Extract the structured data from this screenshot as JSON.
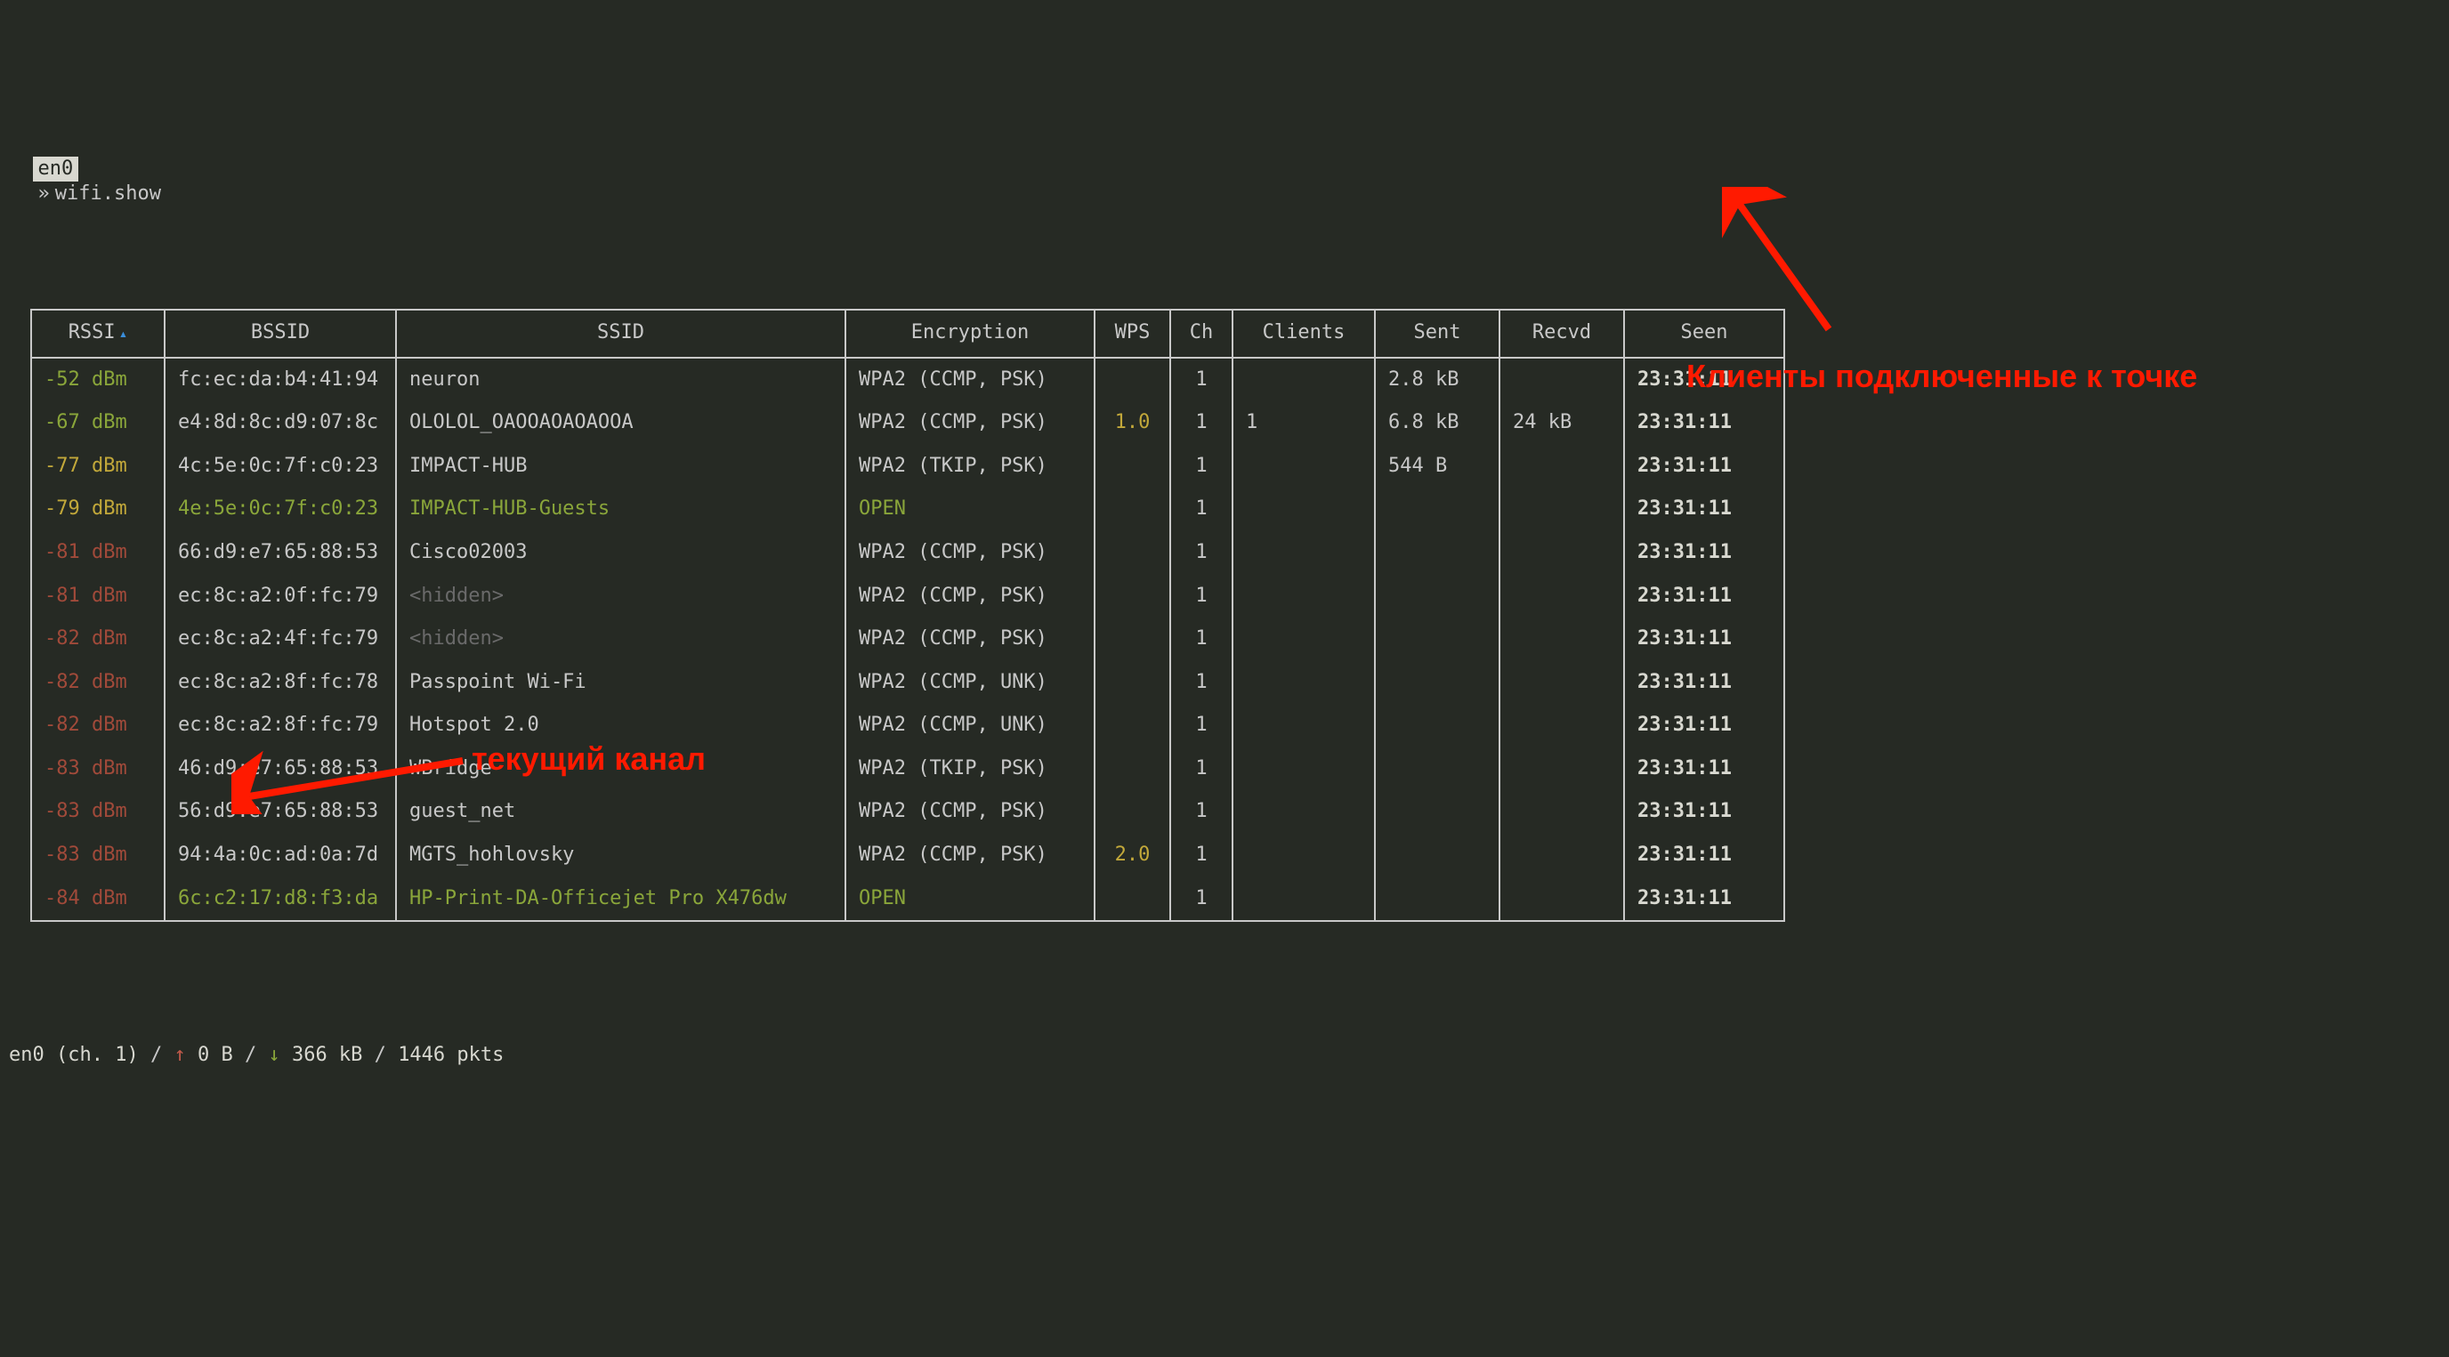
{
  "prompt": {
    "interface": "en0",
    "arrow": "»",
    "command": "wifi.show"
  },
  "columns": [
    "RSSI",
    "BSSID",
    "SSID",
    "Encryption",
    "WPS",
    "Ch",
    "Clients",
    "Sent",
    "Recvd",
    "Seen"
  ],
  "sort": {
    "column": "RSSI",
    "direction_glyph": "▴"
  },
  "rows": [
    {
      "rssi": "-52 dBm",
      "rssi_class": "c-green",
      "bssid": "fc:ec:da:b4:41:94",
      "bssid_class": "",
      "ssid": "neuron",
      "ssid_class": "",
      "enc": "WPA2 (CCMP, PSK)",
      "enc_class": "",
      "wps": "",
      "wps_class": "",
      "ch": "1",
      "clients": "",
      "sent": "2.8 kB",
      "recvd": "",
      "seen": "23:31:11"
    },
    {
      "rssi": "-67 dBm",
      "rssi_class": "c-green",
      "bssid": "e4:8d:8c:d9:07:8c",
      "bssid_class": "",
      "ssid": "OLOLOL_OAOOAOAOAOOA",
      "ssid_class": "",
      "enc": "WPA2 (CCMP, PSK)",
      "enc_class": "",
      "wps": "1.0",
      "wps_class": "c-yellow",
      "ch": "1",
      "clients": "1",
      "sent": "6.8 kB",
      "recvd": "24 kB",
      "seen": "23:31:11"
    },
    {
      "rssi": "-77 dBm",
      "rssi_class": "c-yellow",
      "bssid": "4c:5e:0c:7f:c0:23",
      "bssid_class": "",
      "ssid": "IMPACT-HUB",
      "ssid_class": "",
      "enc": "WPA2 (TKIP, PSK)",
      "enc_class": "",
      "wps": "",
      "wps_class": "",
      "ch": "1",
      "clients": "",
      "sent": "544 B",
      "recvd": "",
      "seen": "23:31:11"
    },
    {
      "rssi": "-79 dBm",
      "rssi_class": "c-yellow",
      "bssid": "4e:5e:0c:7f:c0:23",
      "bssid_class": "c-green",
      "ssid": "IMPACT-HUB-Guests",
      "ssid_class": "c-green",
      "enc": "OPEN",
      "enc_class": "c-green",
      "wps": "",
      "wps_class": "",
      "ch": "1",
      "clients": "",
      "sent": "",
      "recvd": "",
      "seen": "23:31:11"
    },
    {
      "rssi": "-81 dBm",
      "rssi_class": "c-red",
      "bssid": "66:d9:e7:65:88:53",
      "bssid_class": "",
      "ssid": "Cisco02003",
      "ssid_class": "",
      "enc": "WPA2 (CCMP, PSK)",
      "enc_class": "",
      "wps": "",
      "wps_class": "",
      "ch": "1",
      "clients": "",
      "sent": "",
      "recvd": "",
      "seen": "23:31:11"
    },
    {
      "rssi": "-81 dBm",
      "rssi_class": "c-red",
      "bssid": "ec:8c:a2:0f:fc:79",
      "bssid_class": "",
      "ssid": "<hidden>",
      "ssid_class": "c-dim",
      "enc": "WPA2 (CCMP, PSK)",
      "enc_class": "",
      "wps": "",
      "wps_class": "",
      "ch": "1",
      "clients": "",
      "sent": "",
      "recvd": "",
      "seen": "23:31:11"
    },
    {
      "rssi": "-82 dBm",
      "rssi_class": "c-red",
      "bssid": "ec:8c:a2:4f:fc:79",
      "bssid_class": "",
      "ssid": "<hidden>",
      "ssid_class": "c-dim",
      "enc": "WPA2 (CCMP, PSK)",
      "enc_class": "",
      "wps": "",
      "wps_class": "",
      "ch": "1",
      "clients": "",
      "sent": "",
      "recvd": "",
      "seen": "23:31:11"
    },
    {
      "rssi": "-82 dBm",
      "rssi_class": "c-red",
      "bssid": "ec:8c:a2:8f:fc:78",
      "bssid_class": "",
      "ssid": "Passpoint Wi-Fi",
      "ssid_class": "",
      "enc": "WPA2 (CCMP, UNK)",
      "enc_class": "",
      "wps": "",
      "wps_class": "",
      "ch": "1",
      "clients": "",
      "sent": "",
      "recvd": "",
      "seen": "23:31:11"
    },
    {
      "rssi": "-82 dBm",
      "rssi_class": "c-red",
      "bssid": "ec:8c:a2:8f:fc:79",
      "bssid_class": "",
      "ssid": "Hotspot 2.0",
      "ssid_class": "",
      "enc": "WPA2 (CCMP, UNK)",
      "enc_class": "",
      "wps": "",
      "wps_class": "",
      "ch": "1",
      "clients": "",
      "sent": "",
      "recvd": "",
      "seen": "23:31:11"
    },
    {
      "rssi": "-83 dBm",
      "rssi_class": "c-red",
      "bssid": "46:d9:e7:65:88:53",
      "bssid_class": "",
      "ssid": "WBridge",
      "ssid_class": "",
      "enc": "WPA2 (TKIP, PSK)",
      "enc_class": "",
      "wps": "",
      "wps_class": "",
      "ch": "1",
      "clients": "",
      "sent": "",
      "recvd": "",
      "seen": "23:31:11"
    },
    {
      "rssi": "-83 dBm",
      "rssi_class": "c-red",
      "bssid": "56:d9:e7:65:88:53",
      "bssid_class": "",
      "ssid": "guest_net",
      "ssid_class": "",
      "enc": "WPA2 (CCMP, PSK)",
      "enc_class": "",
      "wps": "",
      "wps_class": "",
      "ch": "1",
      "clients": "",
      "sent": "",
      "recvd": "",
      "seen": "23:31:11"
    },
    {
      "rssi": "-83 dBm",
      "rssi_class": "c-red",
      "bssid": "94:4a:0c:ad:0a:7d",
      "bssid_class": "",
      "ssid": "MGTS_hohlovsky",
      "ssid_class": "",
      "enc": "WPA2 (CCMP, PSK)",
      "enc_class": "",
      "wps": "2.0",
      "wps_class": "c-yellow",
      "ch": "1",
      "clients": "",
      "sent": "",
      "recvd": "",
      "seen": "23:31:11"
    },
    {
      "rssi": "-84 dBm",
      "rssi_class": "c-red",
      "bssid": "6c:c2:17:d8:f3:da",
      "bssid_class": "c-green",
      "ssid": "HP-Print-DA-Officejet Pro X476dw",
      "ssid_class": "c-green",
      "enc": "OPEN",
      "enc_class": "c-green",
      "wps": "",
      "wps_class": "",
      "ch": "1",
      "clients": "",
      "sent": "",
      "recvd": "",
      "seen": "23:31:11"
    }
  ],
  "status": {
    "iface_ch": "en0 (ch. 1)",
    "up_arrow": "↑",
    "up": "0 B",
    "down_arrow": "↓",
    "down": "366 kB",
    "pkts": "1446 pkts"
  },
  "annotations": {
    "clients": "Клиенты подключенные к точке",
    "channel": "текущий канал"
  }
}
